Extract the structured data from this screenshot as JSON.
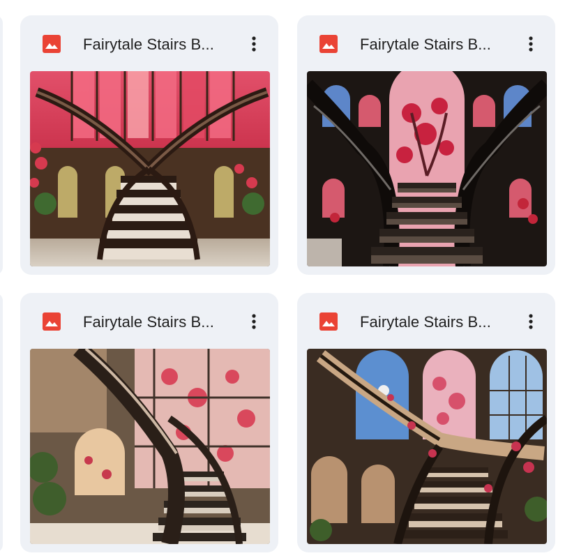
{
  "colors": {
    "card_bg": "#eef1f6",
    "image_icon": "#ea4335",
    "title_text": "#1f1f1f",
    "more_icon": "#1f1f1f"
  },
  "files": [
    {
      "title": "Fairytale Stairs B...",
      "icon": "image-file-icon",
      "thumbnail": "stained-glass-spiral-staircase-pink"
    },
    {
      "title": "Fairytale Stairs B...",
      "icon": "image-file-icon",
      "thumbnail": "stained-glass-twin-staircase-dark"
    },
    {
      "title": "Fairytale Stairs B...",
      "icon": "image-file-icon",
      "thumbnail": "stained-glass-curved-staircase-warm"
    },
    {
      "title": "Fairytale Stairs B...",
      "icon": "image-file-icon",
      "thumbnail": "stained-glass-twin-staircase-blue"
    }
  ]
}
